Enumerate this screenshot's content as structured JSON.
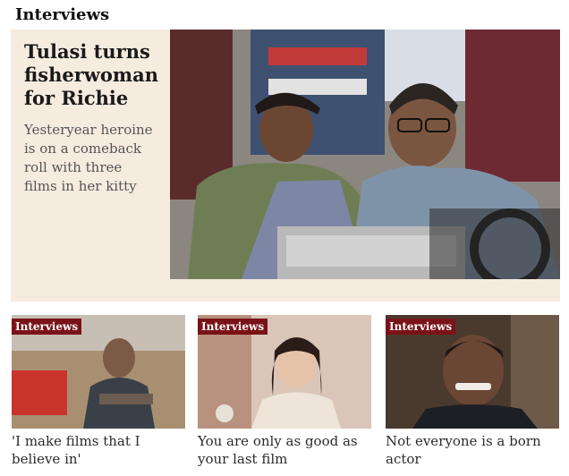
{
  "section": {
    "title": "Interviews"
  },
  "featured": {
    "headline": "Tulasi turns fisherwoman for Richie",
    "standfirst": "Yesteryear heroine is on a comeback roll with three films in her kitty"
  },
  "cards": [
    {
      "badge": "Interviews",
      "caption": "'I make films that I believe in'"
    },
    {
      "badge": "Interviews",
      "caption": "You are only as good as your last film"
    },
    {
      "badge": "Interviews",
      "caption": "Not everyone is a born actor"
    }
  ]
}
